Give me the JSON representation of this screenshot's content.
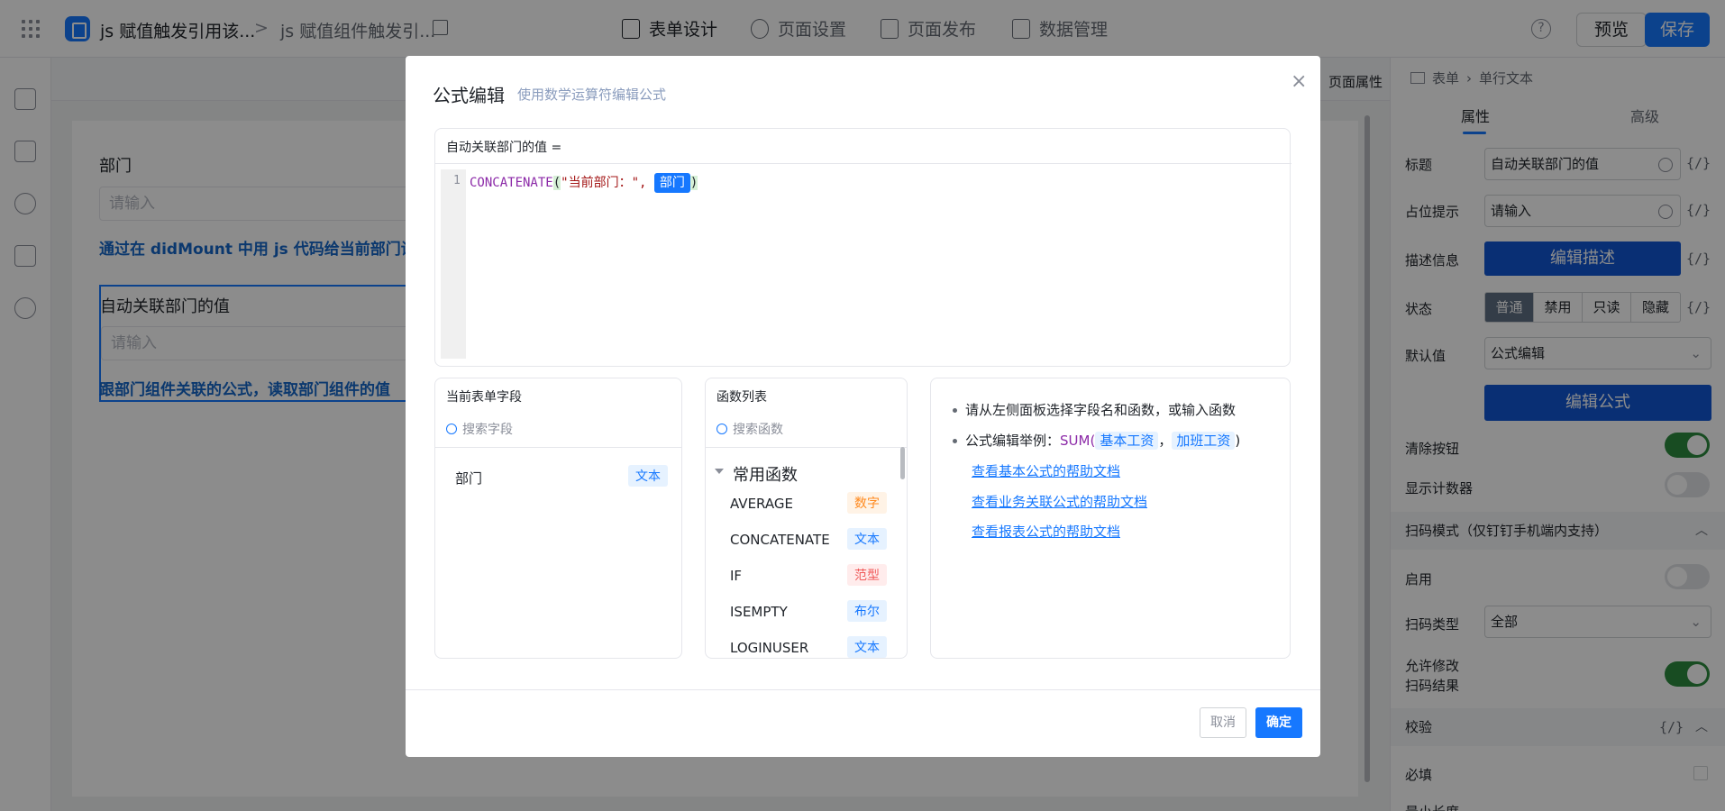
{
  "topbar": {
    "crumb1": "js 赋值触发引用该...",
    "crumb_sep": ">",
    "crumb2": "js 赋值组件触发引...",
    "tabs": [
      "表单设计",
      "页面设置",
      "页面发布",
      "数据管理"
    ],
    "help": "?",
    "preview": "预览",
    "save": "保存"
  },
  "canvas": {
    "page_prop": "页面属性",
    "field1_label": "部门",
    "field1_placeholder": "请输入",
    "desc1": "通过在 didMount 中用 js 代码给当前部门设",
    "field2_label": "自动关联部门的值",
    "field2_placeholder": "请输入",
    "desc2": "跟部门组件关联的公式，读取部门组件的值"
  },
  "rpanel": {
    "crumb_a": "表单",
    "crumb_b": "单行文本",
    "tab_props": "属性",
    "tab_advanced": "高级",
    "title_label": "标题",
    "title_value": "自动关联部门的值",
    "placeholder_label": "占位提示",
    "placeholder_value": "请输入",
    "desc_label": "描述信息",
    "desc_button": "编辑描述",
    "state_label": "状态",
    "states": [
      "普通",
      "禁用",
      "只读",
      "隐藏"
    ],
    "default_label": "默认值",
    "default_value": "公式编辑",
    "formula_button": "编辑公式",
    "clear_label": "清除按钮",
    "counter_label": "显示计数器",
    "scan_section": "扫码模式（仅钉钉手机端内支持）",
    "enable_label": "启用",
    "scan_type_label": "扫码类型",
    "scan_type_value": "全部",
    "allow_edit_label": "允许修改",
    "allow_edit_label2": "扫码结果",
    "validate_section": "校验",
    "required_label": "必填",
    "minlen_label": "最小长度",
    "fx": "{/}"
  },
  "modal": {
    "title": "公式编辑",
    "subtitle": "使用数学运算符编辑公式",
    "close": "×",
    "editor_head": "自动关联部门的值 =",
    "line_no": "1",
    "code_fn": "CONCATENATE",
    "code_open": "(",
    "code_str": "\"当前部门：\",",
    "code_tag": "部门",
    "code_close": ")",
    "fields_head": "当前表单字段",
    "fields_search": "搜索字段",
    "fields": [
      {
        "name": "部门",
        "type": "文本"
      }
    ],
    "funcs_head": "函数列表",
    "funcs_search": "搜索函数",
    "func_group": "常用函数",
    "funcs": [
      {
        "name": "AVERAGE",
        "type": "数字"
      },
      {
        "name": "CONCATENATE",
        "type": "文本"
      },
      {
        "name": "IF",
        "type": "范型"
      },
      {
        "name": "ISEMPTY",
        "type": "布尔"
      },
      {
        "name": "LOGINUSER",
        "type": "文本"
      }
    ],
    "tip1": "请从左侧面板选择字段名和函数，或输入函数",
    "tip2_prefix": "公式编辑举例：",
    "tip2_sum": "SUM(",
    "tip2_a": "基本工资",
    "tip2_comma": "，",
    "tip2_b": "加班工资",
    "tip2_end": ")",
    "links": [
      "查看基本公式的帮助文档",
      "查看业务关联公式的帮助文档",
      "查看报表公式的帮助文档"
    ],
    "cancel": "取消",
    "ok": "确定"
  }
}
